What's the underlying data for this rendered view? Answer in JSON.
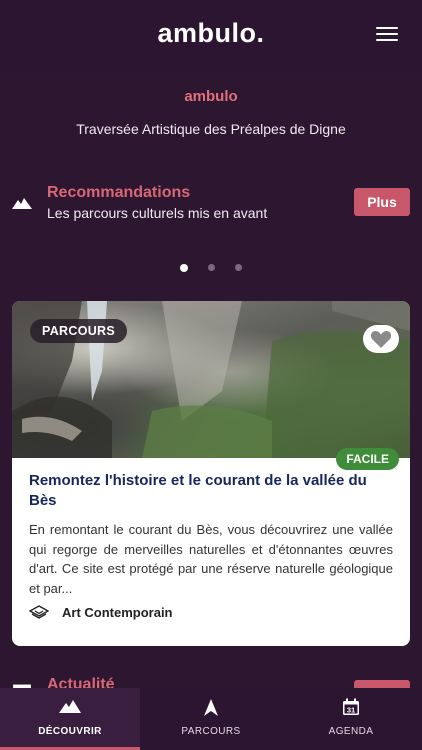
{
  "header": {
    "brand": "ambulo.",
    "menu_icon": "hamburger-menu-icon"
  },
  "hero": {
    "logo_text": "ambulo",
    "tagline": "Traversée Artistique des Préalpes de Digne"
  },
  "recommendations": {
    "icon": "mountain-icon",
    "title": "Recommandations",
    "subtitle": "Les parcours culturels mis en avant",
    "more_label": "Plus"
  },
  "carousel": {
    "pages": 3,
    "active_index": 0
  },
  "card": {
    "badge": "PARCOURS",
    "favorite_icon": "heart-icon",
    "difficulty": "FACILE",
    "title": "Remontez l'histoire et le courant de la vallée du Bès",
    "description": "En remontant le courant du Bès, vous découvrirez une vallée qui regorge de merveilles naturelles et d'étonnantes œuvres d'art. Ce site est protégé par une réserve naturelle géologique et par...",
    "category_icon": "layers-icon",
    "category": "Art Contemporain"
  },
  "news": {
    "title": "Actualité"
  },
  "tabs": [
    {
      "label": "DÉCOUVRIR",
      "icon": "mountain-icon",
      "active": true
    },
    {
      "label": "PARCOURS",
      "icon": "navigation-arrow-icon",
      "active": false
    },
    {
      "label": "AGENDA",
      "icon": "calendar-icon",
      "calendar_day": "31",
      "active": false
    }
  ],
  "colors": {
    "background": "#2c1630",
    "accent": "#c9576a",
    "title_pink": "#d96876",
    "card_title": "#16275d",
    "easy_green": "#3f8c3a"
  }
}
